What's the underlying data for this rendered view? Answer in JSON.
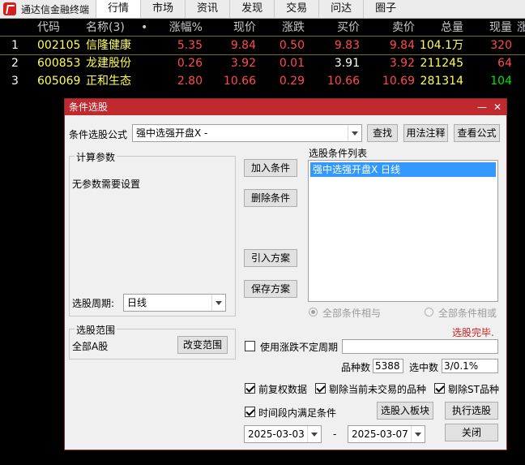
{
  "app": {
    "title": "通达信金融终端"
  },
  "menu": [
    "行情",
    "市场",
    "资讯",
    "发现",
    "交易",
    "问达",
    "圈子"
  ],
  "grid": {
    "headers": {
      "idx": "",
      "code": "代码",
      "name": "名称(3)",
      "dot": "•",
      "pct": "涨幅%",
      "price": "现价",
      "change": "涨跌",
      "bid": "买价",
      "ask": "卖价",
      "vol": "总量",
      "cur": "现量",
      "extra": "涨"
    },
    "rows": [
      {
        "idx": "1",
        "code": "002105",
        "name": "信隆健康",
        "pct": "5.35",
        "price": "9.84",
        "change": "0.50",
        "bid": "9.83",
        "ask": "9.84",
        "vol": "104.1万",
        "cur": "320"
      },
      {
        "idx": "2",
        "code": "600853",
        "name": "龙建股份",
        "pct": "0.26",
        "price": "3.92",
        "change": "0.01",
        "bid": "3.91",
        "ask": "3.92",
        "vol": "211245",
        "cur": "64"
      },
      {
        "idx": "3",
        "code": "605069",
        "name": "正和生态",
        "pct": "2.80",
        "price": "10.66",
        "change": "0.29",
        "bid": "10.66",
        "ask": "10.69",
        "vol": "281314",
        "cur": "104"
      }
    ]
  },
  "dialog": {
    "title": "条件选股",
    "minimize": "—",
    "close": "✕",
    "formula_label": "条件选股公式",
    "formula_value": "强中选强开盘X -",
    "find_btn": "查找",
    "usage_btn": "用法注释",
    "view_btn": "查看公式",
    "params_group": "计算参数",
    "params_text": "无参数需要设置",
    "period_label": "选股周期:",
    "period_value": "日线",
    "add_btn": "加入条件",
    "del_btn": "删除条件",
    "import_btn": "引入方案",
    "save_btn": "保存方案",
    "list_label": "选股条件列表",
    "list_items": [
      "强中选强开盘X  日线"
    ],
    "radio_and": "全部条件相与",
    "radio_or": "全部条件相或",
    "status": "选股完毕.",
    "range_group": "选股范围",
    "range_value": "全部A股",
    "range_btn": "改变范围",
    "use_period_label": "使用涨跌不定周期",
    "count_label": "品种数",
    "count_value": "5388",
    "selected_label": "选中数",
    "selected_value": "3/0.1%",
    "opt1": "前复权数据",
    "opt2": "剔除当前未交易的品种",
    "opt3": "剔除ST品种",
    "time_cond": "时间段内满足条件",
    "to_block_btn": "选股入板块",
    "exec_btn": "执行选股",
    "date_from": "2025-03-03",
    "date_sep": "-",
    "date_to": "2025-03-07",
    "close_btn": "关闭"
  }
}
